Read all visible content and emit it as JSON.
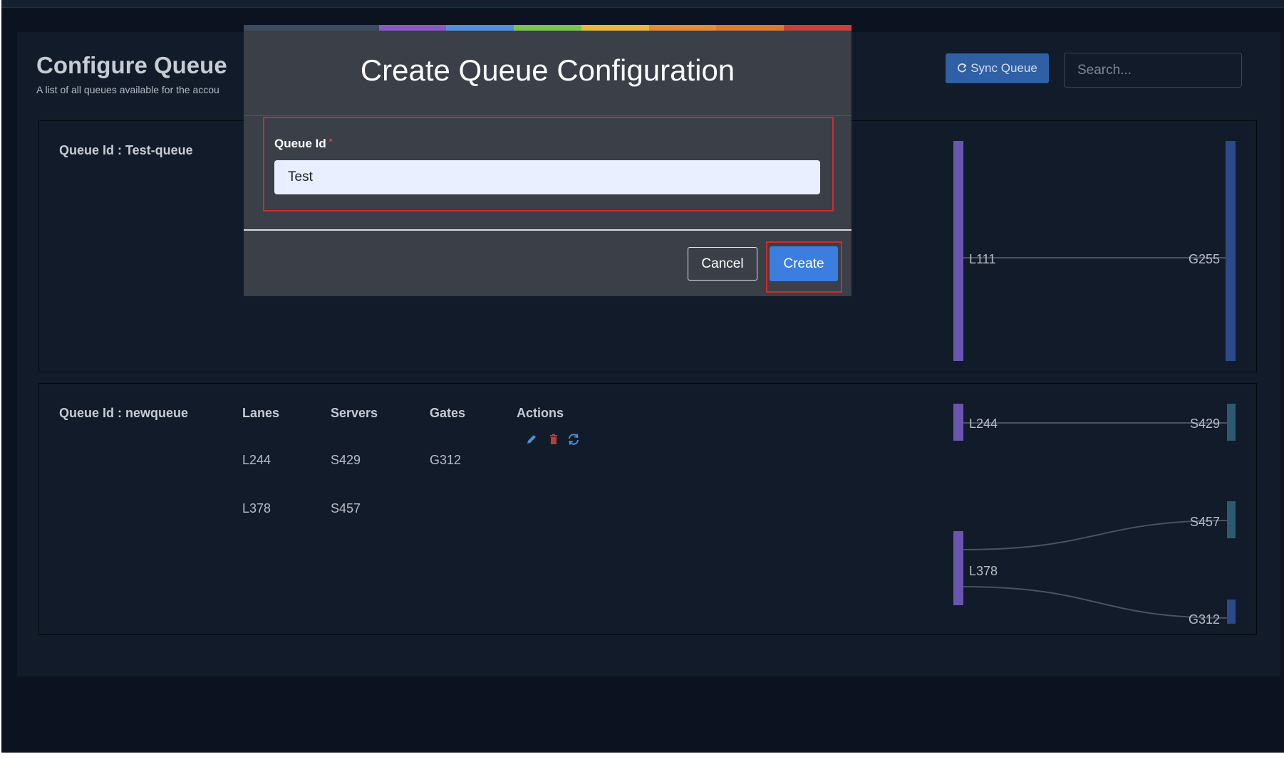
{
  "page": {
    "title": "Configure Queue",
    "subtitle": "A list of all queues available for the accou"
  },
  "toolbar": {
    "sync_label": "Sync Queue",
    "sync_icon": "refresh-icon",
    "search_placeholder": "Search...",
    "search_value": ""
  },
  "queues": [
    {
      "id_label": "Queue Id : Test-queue",
      "sankey": {
        "left": [
          "L111"
        ],
        "right": [
          "G255"
        ]
      }
    },
    {
      "id_label": "Queue Id : newqueue",
      "columns": {
        "lanes": "Lanes",
        "servers": "Servers",
        "gates": "Gates",
        "actions": "Actions"
      },
      "rows": [
        {
          "lane": "L244",
          "server": "S429",
          "gate": "G312"
        },
        {
          "lane": "L378",
          "server": "S457",
          "gate": ""
        }
      ],
      "actions": [
        "edit-icon",
        "delete-icon",
        "refresh-icon"
      ],
      "sankey": {
        "left": [
          "L244",
          "L378"
        ],
        "right": [
          "S429",
          "S457",
          "G312"
        ]
      }
    }
  ],
  "modal": {
    "title": "Create Queue Configuration",
    "field_label": "Queue Id",
    "required_mark": "*",
    "field_value": "Test",
    "cancel_label": "Cancel",
    "create_label": "Create",
    "stripe_colors": [
      "#3d4b60",
      "#3d4b60",
      "#8c58c8",
      "#4d91e0",
      "#7cc450",
      "#eab73a",
      "#e68a33",
      "#e0782f",
      "#c9403a"
    ]
  },
  "colors": {
    "background": "#0c1220",
    "panel": "#121b2a",
    "accent": "#2f5fa4",
    "primary_button": "#3c7ee0",
    "highlight": "#d42a2a",
    "lane_bar": "#6a55b0",
    "gate_bar": "#2c4a8a",
    "server_bar": "#2e5a6e"
  }
}
